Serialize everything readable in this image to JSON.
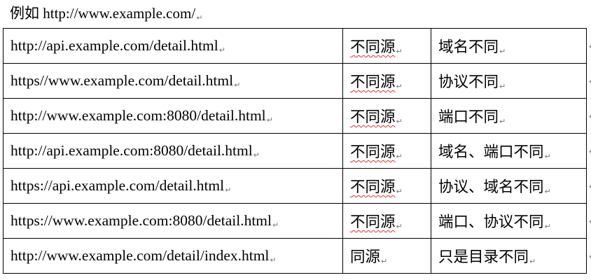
{
  "intro": {
    "text": "例如 http://www.example.com/",
    "mark": "↵"
  },
  "table": {
    "rows": [
      {
        "url": "http://api.example.com/detail.html",
        "result": "不同源",
        "reason": "域名不同",
        "spellcheck": true
      },
      {
        "url": "https//www.example.com/detail.html",
        "result": "不同源",
        "reason": "协议不同",
        "spellcheck": true
      },
      {
        "url": "http://www.example.com:8080/detail.html",
        "result": "不同源",
        "reason": "端口不同",
        "spellcheck": true
      },
      {
        "url": "http://api.example.com:8080/detail.html",
        "result": "不同源",
        "reason": "域名、端口不同",
        "spellcheck": true
      },
      {
        "url": "https://api.example.com/detail.html",
        "result": "不同源",
        "reason": "协议、域名不同",
        "spellcheck": true
      },
      {
        "url": "https://www.example.com:8080/detail.html",
        "result": "不同源",
        "reason": "端口、协议不同",
        "spellcheck": true
      },
      {
        "url": "http://www.example.com/detail/index.html",
        "result": "同源",
        "reason": "只是目录不同",
        "spellcheck": false
      }
    ],
    "mark": "↵"
  }
}
